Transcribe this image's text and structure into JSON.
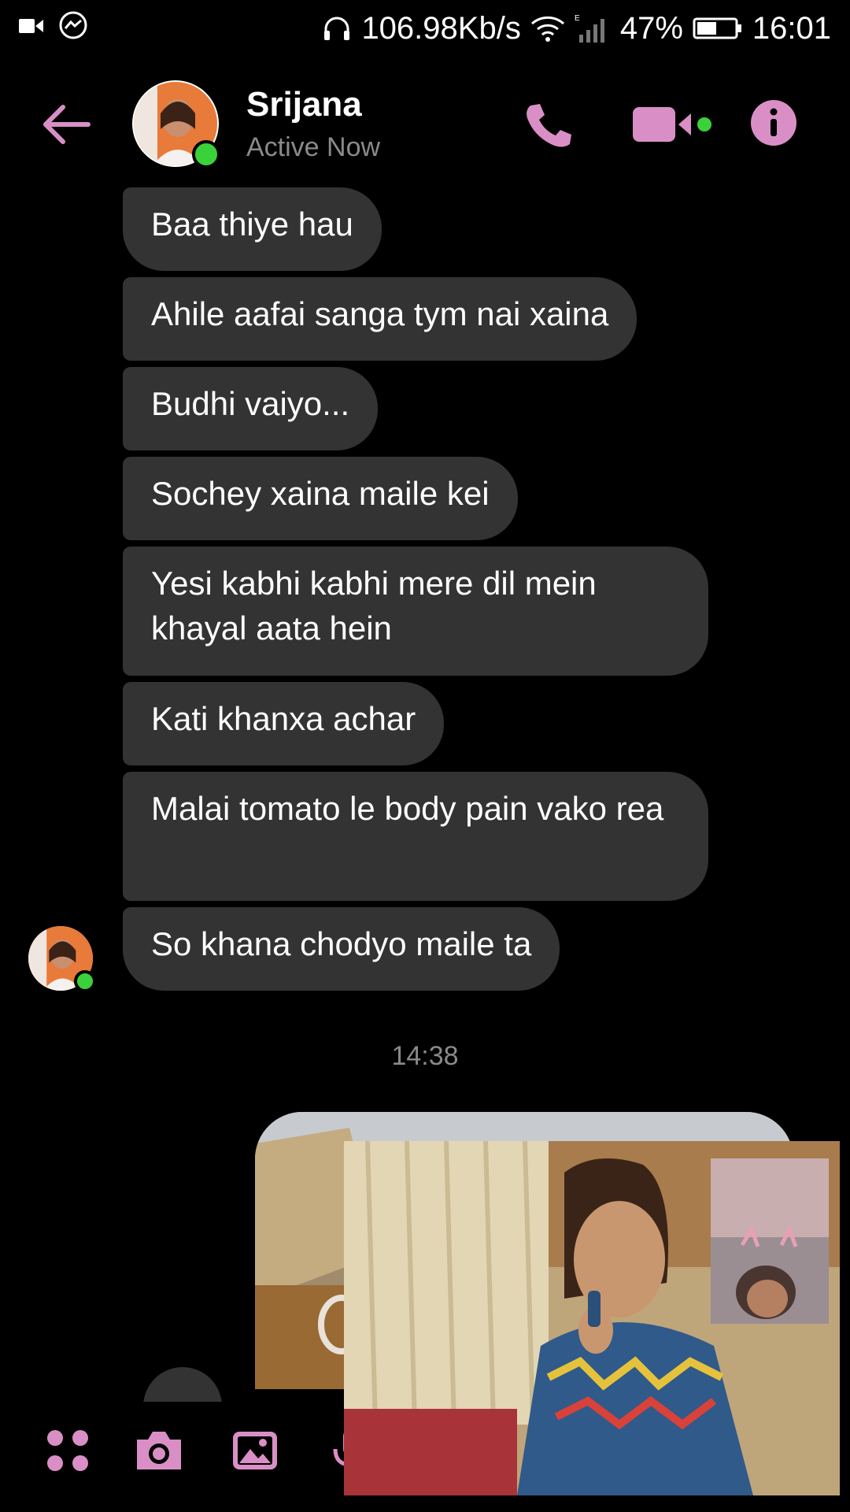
{
  "status_bar": {
    "network_speed": "106.98Kb/s",
    "battery": "47%",
    "time": "16:01"
  },
  "header": {
    "contact_name": "Srijana",
    "contact_status": "Active Now"
  },
  "messages": [
    {
      "text": "Baa thiye hau"
    },
    {
      "text": "Ahile aafai sanga tym nai xaina"
    },
    {
      "text": "Budhi vaiyo..."
    },
    {
      "text": "Sochey xaina maile kei"
    },
    {
      "text": "Yesi kabhi kabhi mere dil mein khayal aata hein"
    },
    {
      "text": "Kati khanxa achar"
    },
    {
      "text": "Malai tomato le body pain vako rea"
    },
    {
      "text": "So khana chodyo maile ta"
    }
  ],
  "timestamp": "14:38",
  "colors": {
    "accent": "#d98fc6",
    "bubble": "#333333",
    "online": "#3ad13a",
    "muted_text": "#8a8a8a"
  },
  "icons": {
    "back": "arrow-left-icon",
    "call": "phone-icon",
    "video": "video-camera-icon",
    "info": "info-icon",
    "apps": "grid-icon",
    "camera": "camera-icon",
    "gallery": "image-icon",
    "mic": "microphone-icon"
  }
}
